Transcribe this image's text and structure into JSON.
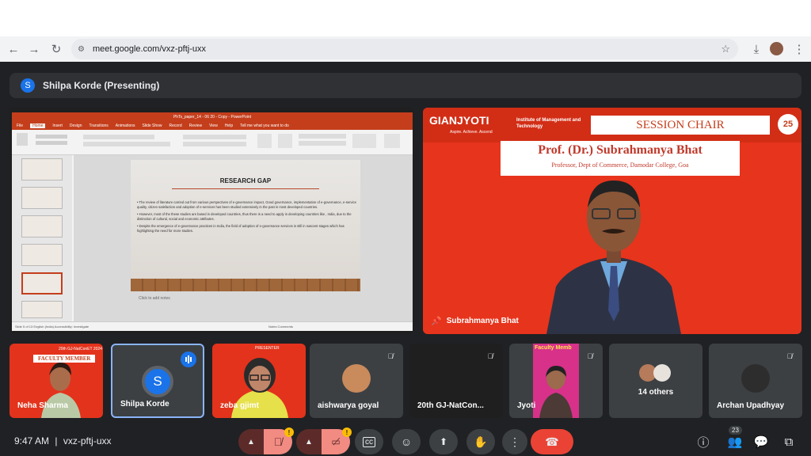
{
  "browser": {
    "url": "meet.google.com/vxz-pftj-uxx"
  },
  "meeting": {
    "presenter_initial": "S",
    "presenting_label": "Shilpa Korde (Presenting)",
    "time": "9:47 AM",
    "code": "vxz-pftj-uxx",
    "participant_count": "23"
  },
  "presentation": {
    "window_title": "PhTs_paper_14 - 06 20 - Copy - PowerPoint",
    "tabs": [
      "File",
      "Home",
      "Insert",
      "Design",
      "Transitions",
      "Animations",
      "Slide Show",
      "Record",
      "Review",
      "View",
      "Help",
      "Tell me what you want to do"
    ],
    "slide_title": "RESEARCH GAP",
    "bullets": [
      "• The review of literature carried out from various perspectives of e-governance impact, Good governance, implementation of e-governance, e-service quality, citizen satisfaction and adoption of e-services has been studied extensively in the past in most developed countries.",
      "• However, most of the these studies are based in developed countries, thus there is a need to apply in developing countries like , India, due to the distinction of cultural, social and economic attributes.",
      "• Despite the emergence of e-governance practices in India, the field of adoption of e-governance services is still in nascent stages which has highlighting the need for more studies."
    ],
    "notes_placeholder": "Click to add notes",
    "status": "Slide 5 of 13    English (India)    Accessibility: Investigate",
    "status_right": "Notes   Comments"
  },
  "speaker": {
    "logo": "GIANJYOTI",
    "logo_tagline": "Aspire. Achieve. Ascend",
    "institute": "Institute of Management and Technology",
    "session_label": "SESSION CHAIR",
    "prof_name": "Prof. (Dr.) Subrahmanya Bhat",
    "prof_desc": "Professor, Dept of Commerce, Damodar College, Goa",
    "badge": "25",
    "name": "Subrahmanya Bhat"
  },
  "tiles": [
    {
      "name": "Neha Sharma",
      "banner": "FACULTY MEMBER",
      "bannertop": "20th GJ-NatConET 2024"
    },
    {
      "name": "Shilpa Korde",
      "initial": "S"
    },
    {
      "name": "zeba gjimt",
      "banner": "PRESENTER"
    },
    {
      "name": "aishwarya goyal"
    },
    {
      "name": "20th GJ-NatCon..."
    },
    {
      "name": "Jyoti",
      "banner": "Faculty Memb"
    },
    {
      "name": "14 others"
    },
    {
      "name": "Archan Upadhyay"
    }
  ],
  "colors": {
    "meet_bg": "#202124",
    "tile_bg": "#3c4043",
    "accent_blue": "#1a73e8",
    "end_call_red": "#ea4335",
    "muted_red": "#5c2b29",
    "warning_yellow": "#fbbc04"
  },
  "icons": {
    "mic": "mic-off-icon",
    "camera": "camera-off-icon",
    "captions": "captions-icon",
    "emoji": "emoji-icon",
    "present": "present-icon",
    "hand": "raise-hand-icon",
    "more": "more-vert-icon",
    "end": "end-call-icon",
    "info": "info-icon",
    "people": "people-icon",
    "chat": "chat-icon",
    "activities": "activities-icon"
  }
}
